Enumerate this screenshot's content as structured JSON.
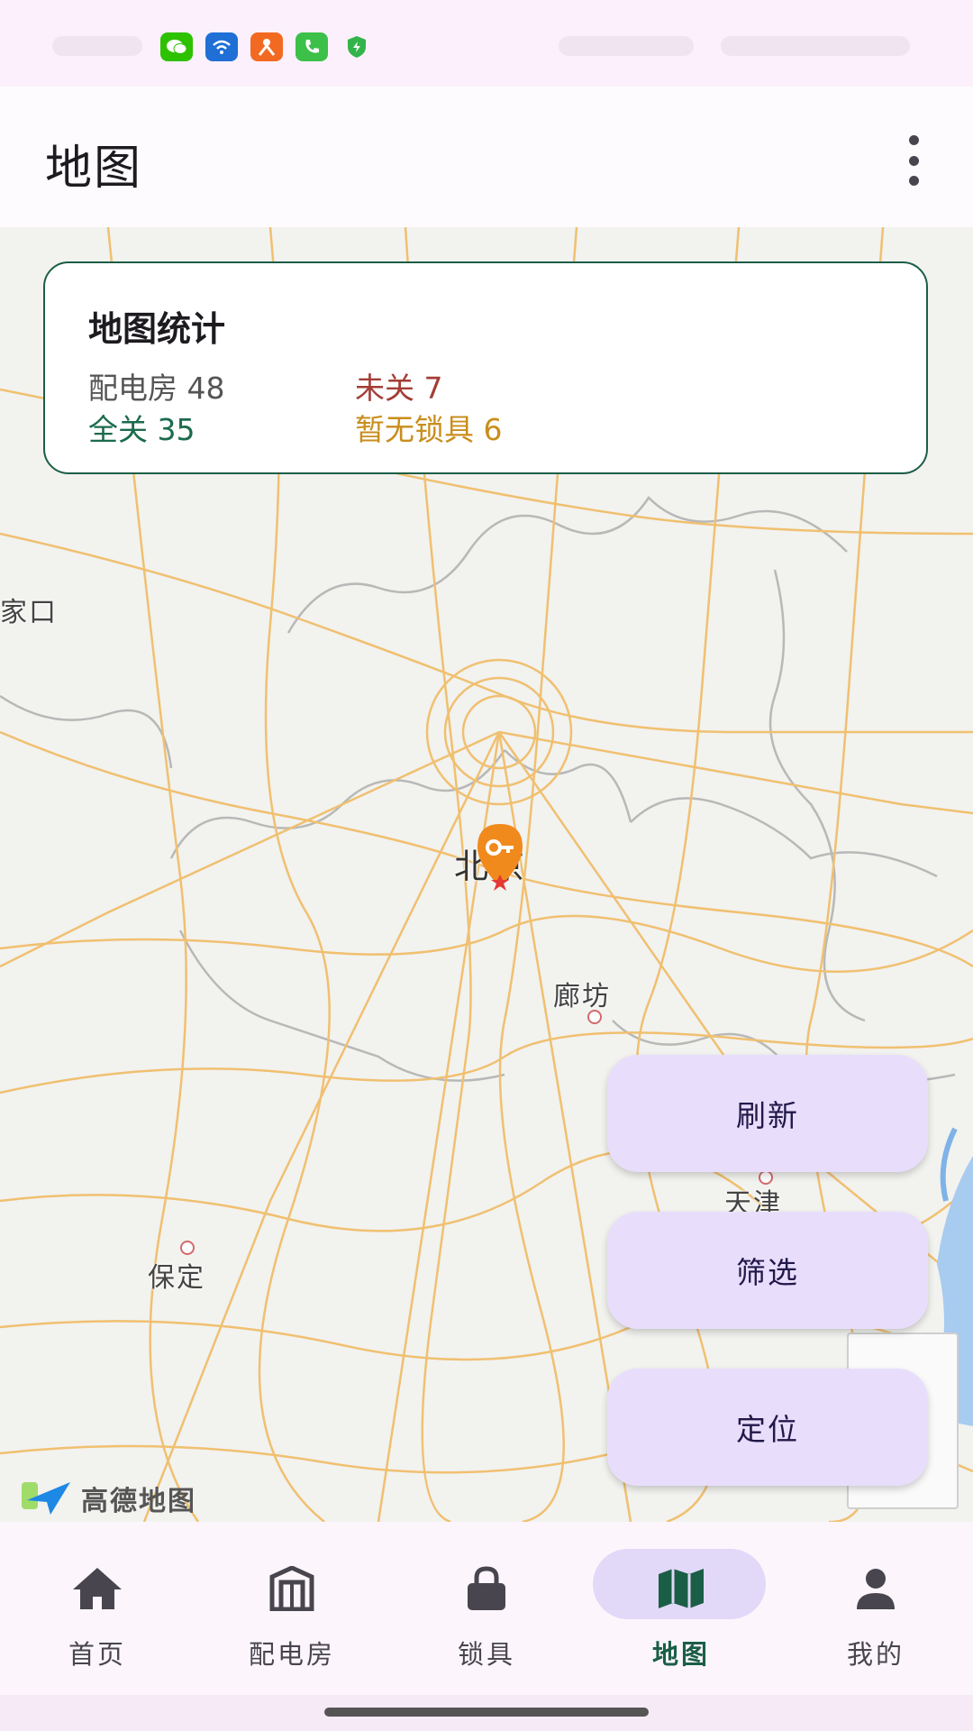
{
  "status_bar": {
    "icons": [
      "wechat-icon",
      "wifi-app-icon",
      "app-icon",
      "phone-icon",
      "shield-icon"
    ]
  },
  "app_bar": {
    "title": "地图",
    "more_icon": "more-vert-icon"
  },
  "stats": {
    "title": "地图统计",
    "total": "配电房 48",
    "open": "未关 7",
    "closed": "全关 35",
    "no_lock": "暂无锁具 6",
    "colors": {
      "border": "#1b5e46",
      "open": "#a33d36",
      "closed": "#1b6b4d",
      "no_lock": "#c98e1c"
    }
  },
  "map": {
    "labels": {
      "zhangjiakou": "家口",
      "beijing": "北京",
      "langfang": "廊坊",
      "tianjin": "天津",
      "baoding": "保定"
    },
    "attribution": "高德地图",
    "marker_icon": "key-pin-icon"
  },
  "fabs": {
    "refresh": "刷新",
    "filter": "筛选",
    "locate": "定位"
  },
  "bottom_nav": {
    "items": [
      {
        "label": "首页",
        "icon": "home-icon"
      },
      {
        "label": "配电房",
        "icon": "building-icon"
      },
      {
        "label": "锁具",
        "icon": "lock-icon"
      },
      {
        "label": "地图",
        "icon": "map-icon"
      },
      {
        "label": "我的",
        "icon": "person-icon"
      }
    ],
    "active": "地图"
  }
}
